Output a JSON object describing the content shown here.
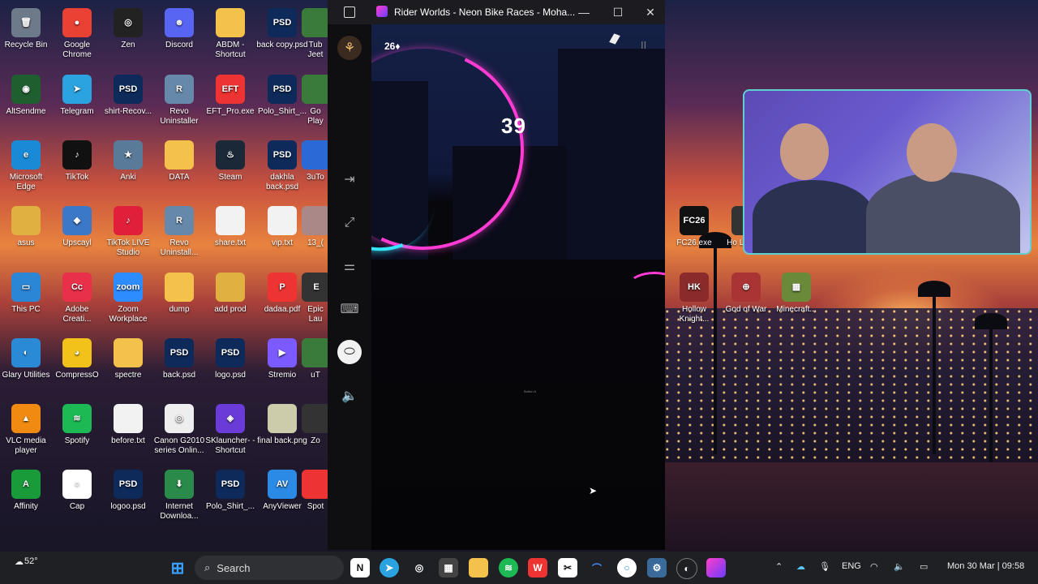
{
  "desktop": {
    "icons": [
      {
        "label": "Recycle Bin",
        "glyph": "🗑",
        "bg": "#6c7a89"
      },
      {
        "label": "Google Chrome",
        "glyph": "●",
        "bg": "#e94235"
      },
      {
        "label": "Zen",
        "glyph": "◎",
        "bg": "#222222"
      },
      {
        "label": "Discord",
        "glyph": "☻",
        "bg": "#5865f2"
      },
      {
        "label": "ABDM - Shortcut",
        "glyph": "",
        "bg": "#f4c24b"
      },
      {
        "label": "back copy.psd",
        "glyph": "PSD",
        "bg": "#0d2a5a"
      },
      {
        "label": "Tub Jeet",
        "glyph": "",
        "bg": "#3a7a3a"
      },
      {
        "label": "AltSendme",
        "glyph": "◉",
        "bg": "#1f5f2f"
      },
      {
        "label": "Telegram",
        "glyph": "➤",
        "bg": "#2aa3e0"
      },
      {
        "label": "shirt-Recov...",
        "glyph": "PSD",
        "bg": "#0d2a5a"
      },
      {
        "label": "Revo Uninstaller",
        "glyph": "R",
        "bg": "#6688aa"
      },
      {
        "label": "EFT_Pro.exe",
        "glyph": "EFT",
        "bg": "#e33"
      },
      {
        "label": "Polo_Shirt_...",
        "glyph": "PSD",
        "bg": "#0d2a5a"
      },
      {
        "label": "Go Play",
        "glyph": "",
        "bg": "#3a7a3a"
      },
      {
        "label": "Microsoft Edge",
        "glyph": "e",
        "bg": "#1a8ad6"
      },
      {
        "label": "TikTok",
        "glyph": "♪",
        "bg": "#111111"
      },
      {
        "label": "Anki",
        "glyph": "★",
        "bg": "#5a7a9a"
      },
      {
        "label": "DATA",
        "glyph": "",
        "bg": "#f4c24b"
      },
      {
        "label": "Steam",
        "glyph": "♨",
        "bg": "#1b2838"
      },
      {
        "label": "dakhla back.psd",
        "glyph": "PSD",
        "bg": "#0d2a5a"
      },
      {
        "label": "3uTo",
        "glyph": "",
        "bg": "#2a6ad6"
      },
      {
        "label": "asus",
        "glyph": "",
        "bg": "#e0b040"
      },
      {
        "label": "Upscayl",
        "glyph": "◆",
        "bg": "#3b78c8"
      },
      {
        "label": "TikTok LIVE Studio",
        "glyph": "♪",
        "bg": "#e0203a"
      },
      {
        "label": "Revo Uninstall...",
        "glyph": "R",
        "bg": "#6688aa"
      },
      {
        "label": "share.txt",
        "glyph": "",
        "bg": "#f2f2f2"
      },
      {
        "label": "vip.txt",
        "glyph": "",
        "bg": "#f2f2f2"
      },
      {
        "label": "13_(",
        "glyph": "",
        "bg": "#a88"
      },
      {
        "label": "This PC",
        "glyph": "▭",
        "bg": "#2b86d6"
      },
      {
        "label": "Adobe Creati...",
        "glyph": "Cc",
        "bg": "#e8304a"
      },
      {
        "label": "Zoom Workplace",
        "glyph": "zoom",
        "bg": "#2d8cff"
      },
      {
        "label": "dump",
        "glyph": "",
        "bg": "#f4c24b"
      },
      {
        "label": "add prod",
        "glyph": "",
        "bg": "#e0b040"
      },
      {
        "label": "dadaa.pdf",
        "glyph": "P",
        "bg": "#e33"
      },
      {
        "label": "Epic Lau",
        "glyph": "E",
        "bg": "#333"
      },
      {
        "label": "Glary Utilities",
        "glyph": "◐",
        "bg": "#2a8ad6"
      },
      {
        "label": "CompressO",
        "glyph": "◕",
        "bg": "#f2c21b"
      },
      {
        "label": "spectre",
        "glyph": "",
        "bg": "#f4c24b"
      },
      {
        "label": "back.psd",
        "glyph": "PSD",
        "bg": "#0d2a5a"
      },
      {
        "label": "logo.psd",
        "glyph": "PSD",
        "bg": "#0d2a5a"
      },
      {
        "label": "Stremio",
        "glyph": "▶",
        "bg": "#7b5bff"
      },
      {
        "label": "uT",
        "glyph": "",
        "bg": "#3a7a3a"
      },
      {
        "label": "VLC media player",
        "glyph": "▲",
        "bg": "#f08a10"
      },
      {
        "label": "Spotify",
        "glyph": "≋",
        "bg": "#1db954"
      },
      {
        "label": "before.txt",
        "glyph": "",
        "bg": "#f2f2f2"
      },
      {
        "label": "Canon G2010 series Onlin...",
        "glyph": "◎",
        "bg": "#eeeeee"
      },
      {
        "label": "SKlauncher- - Shortcut",
        "glyph": "◈",
        "bg": "#6a3bd6"
      },
      {
        "label": "final back.png",
        "glyph": "",
        "bg": "#ccccaa"
      },
      {
        "label": "Zo",
        "glyph": "",
        "bg": "#333"
      },
      {
        "label": "Affinity",
        "glyph": "A",
        "bg": "#1a9b3a"
      },
      {
        "label": "Cap",
        "glyph": "○",
        "bg": "#ffffff"
      },
      {
        "label": "logoo.psd",
        "glyph": "PSD",
        "bg": "#0d2a5a"
      },
      {
        "label": "Internet Downloa...",
        "glyph": "⬇",
        "bg": "#2a8a4a"
      },
      {
        "label": "Polo_Shirt_...",
        "glyph": "PSD",
        "bg": "#0d2a5a"
      },
      {
        "label": "AnyViewer",
        "glyph": "AV",
        "bg": "#2a8ae6"
      },
      {
        "label": "Spot",
        "glyph": "",
        "bg": "#e33"
      }
    ],
    "right_icons": [
      {
        "label": "FC26.exe",
        "glyph": "FC26",
        "bg": "#111111"
      },
      {
        "label": "Ho Legacy",
        "glyph": "",
        "bg": "#333"
      },
      {
        "label": "Hollow Knight...",
        "glyph": "HK",
        "bg": "#8a2a2a"
      },
      {
        "label": "God of War",
        "glyph": "⊕",
        "bg": "#aa3333"
      },
      {
        "label": "Minecraft...",
        "glyph": "▦",
        "bg": "#6a8a3a"
      }
    ]
  },
  "window": {
    "title": "Rider Worlds - Neon Bike Races - Moha...",
    "minimize": "—",
    "maximize": "☐",
    "close": "✕",
    "game": {
      "gems": "26♦",
      "score": "39",
      "pause": "II",
      "tiny_text": "Button A"
    }
  },
  "taskbar": {
    "weather": "52°",
    "search_placeholder": "Search",
    "language": "ENG",
    "datetime": "Mon 30 Mar | 09:58"
  }
}
